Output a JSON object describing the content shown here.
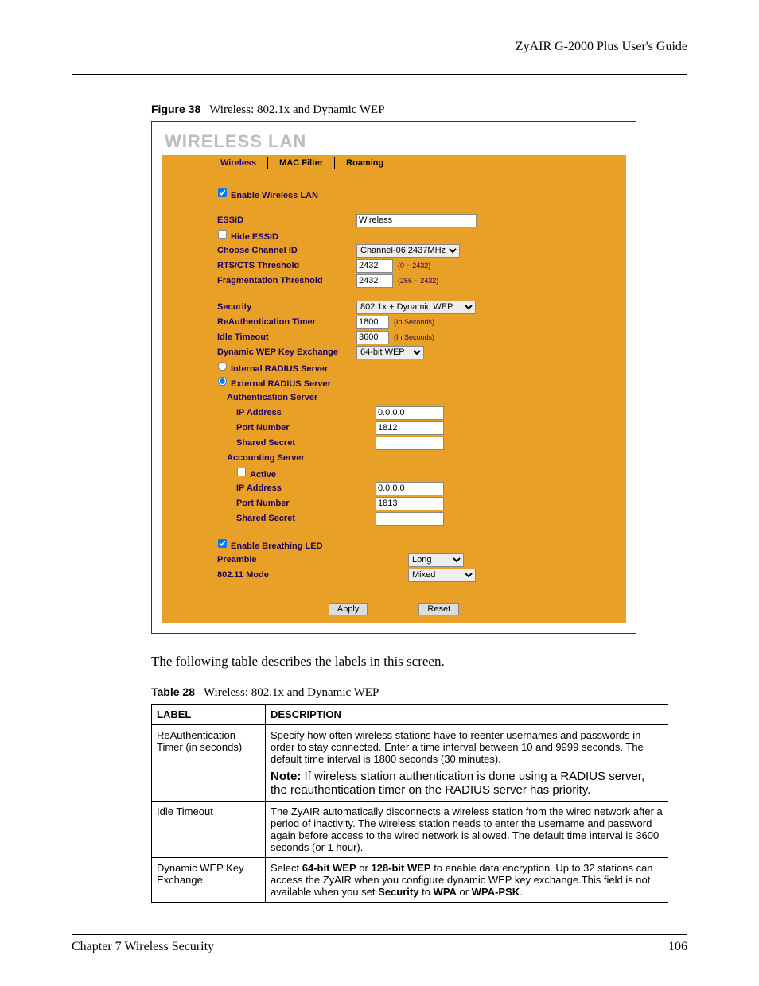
{
  "header": {
    "title": "ZyAIR G-2000 Plus User's Guide"
  },
  "figure": {
    "label": "Figure 38",
    "caption": "Wireless: 802.1x and Dynamic WEP"
  },
  "panel": {
    "title": "WIRELESS LAN",
    "tabs": {
      "wireless": "Wireless",
      "macfilter": "MAC Filter",
      "roaming": "Roaming"
    },
    "enable_wlan": "Enable Wireless LAN",
    "essid_label": "ESSID",
    "essid_value": "Wireless",
    "hide_essid": "Hide ESSID",
    "channel_label": "Choose Channel ID",
    "channel_value": "Channel-06 2437MHz",
    "rts_label": "RTS/CTS  Threshold",
    "rts_value": "2432",
    "rts_hint": "(0 ~ 2432)",
    "frag_label": "Fragmentation  Threshold",
    "frag_value": "2432",
    "frag_hint": "(256 ~ 2432)",
    "security_label": "Security",
    "security_value": "802.1x + Dynamic WEP",
    "reauth_label": "ReAuthentication Timer",
    "reauth_value": "1800",
    "reauth_hint": "(In Seconds)",
    "idle_label": "Idle Timeout",
    "idle_value": "3600",
    "idle_hint": "(In Seconds)",
    "dwep_label": "Dynamic WEP Key Exchange",
    "dwep_value": "64-bit WEP",
    "internal_radius": "Internal RADIUS Server",
    "external_radius": "External RADIUS Server",
    "auth_server": "Authentication Server",
    "ip_label": "IP Address",
    "auth_ip": "0.0.0.0",
    "port_label": "Port Number",
    "auth_port": "1812",
    "secret_label": "Shared Secret",
    "acct_server": "Accounting Server",
    "active_label": "Active",
    "acct_ip": "0.0.0.0",
    "acct_port": "1813",
    "breathing_led": "Enable Breathing LED",
    "preamble_label": "Preamble",
    "preamble_value": "Long",
    "mode_label": "802.11 Mode",
    "mode_value": "Mixed",
    "apply": "Apply",
    "reset": "Reset"
  },
  "paragraph": "The following table describes the labels in this screen.",
  "table": {
    "label": "Table 28",
    "caption": "Wireless: 802.1x and Dynamic WEP",
    "head_label": "LABEL",
    "head_desc": "DESCRIPTION",
    "rows": [
      {
        "label": "ReAuthentication Timer (in seconds)",
        "desc": "Specify how often wireless stations have to reenter usernames and passwords in order to stay connected. Enter a time interval between 10 and 9999 seconds. The default time interval is 1800 seconds (30 minutes).",
        "note": "Note: If wireless station authentication is done using a RADIUS server, the reauthentication timer on the RADIUS server has priority."
      },
      {
        "label": "Idle Timeout",
        "desc": "The ZyAIR automatically disconnects a wireless station from the wired network after a period of inactivity. The wireless station needs to enter the username and password again before access to the wired network is allowed. The default time interval is 3600 seconds (or 1 hour)."
      },
      {
        "label": "Dynamic WEP Key Exchange",
        "desc_html": "Select <b>64-bit WEP</b> or <b>128-bit WEP</b> to enable data encryption. Up to 32 stations can access the ZyAIR when you configure dynamic WEP key exchange.This field is not available when you set <b>Security</b> to <b>WPA</b> or <b>WPA-PSK</b>."
      }
    ]
  },
  "footer": {
    "chapter": "Chapter 7 Wireless Security",
    "page": "106"
  }
}
